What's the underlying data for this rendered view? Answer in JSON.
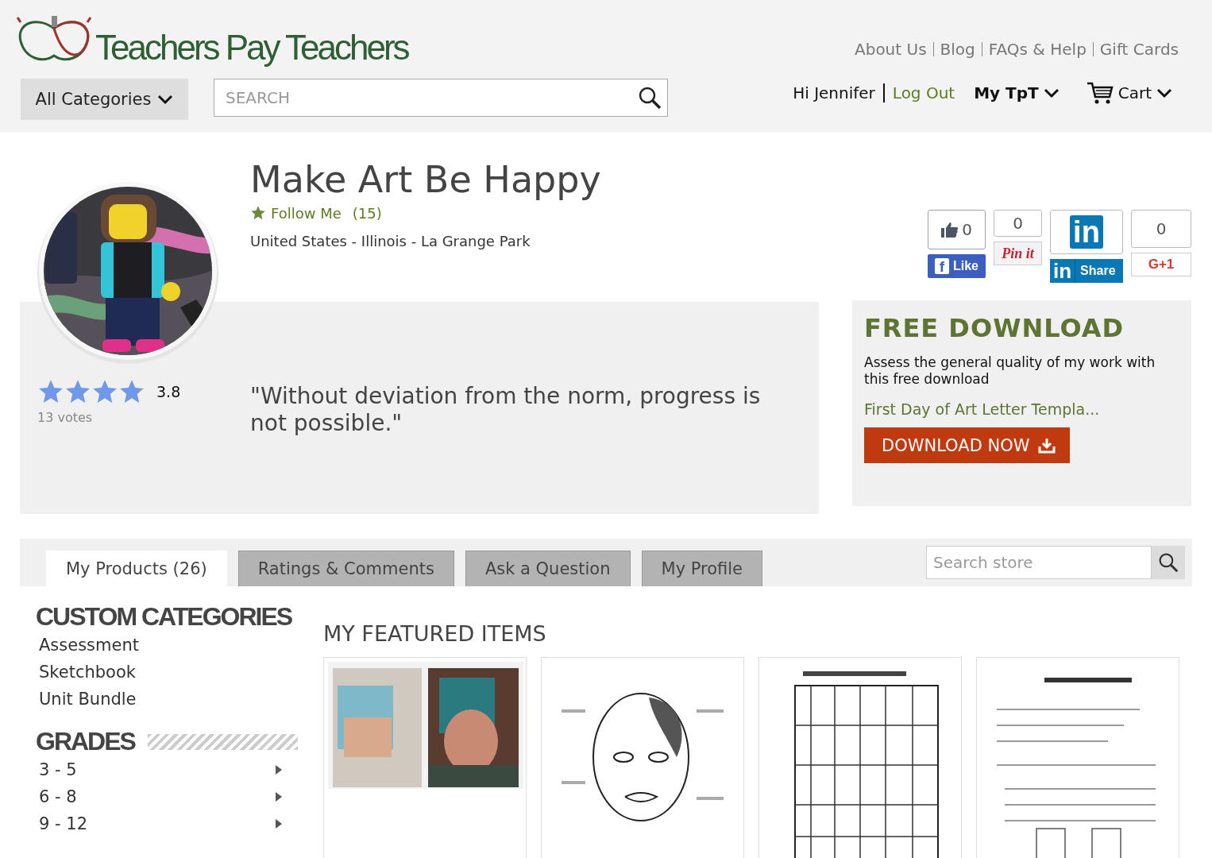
{
  "header": {
    "logo": "Teachers Pay Teachers",
    "top_links": [
      "About Us",
      "Blog",
      "FAQs & Help",
      "Gift Cards"
    ],
    "categories_button": "All Categories",
    "search": {
      "placeholder": "SEARCH"
    },
    "greeting": "Hi Jennifer",
    "logout": "Log Out",
    "my_tpt": "My TpT",
    "cart": "Cart"
  },
  "store": {
    "name": "Make Art Be Happy",
    "follow": "Follow Me",
    "followers": "(15)",
    "location": "United States - Illinois - La Grange Park",
    "rating": {
      "stars": 3.8,
      "value": "3.8",
      "votes": "13 votes"
    },
    "quote": "\"Without deviation from the norm, progress is not possible.\""
  },
  "social": [
    {
      "kind": "facebook",
      "count": "0",
      "mark": "f",
      "label": "Like"
    },
    {
      "kind": "pinterest",
      "count": "0",
      "label": "Pin it"
    },
    {
      "kind": "linkedin",
      "logo": "in",
      "mark": "in",
      "label": "Share"
    },
    {
      "kind": "google",
      "count": "0",
      "label": "G+1"
    }
  ],
  "free_download": {
    "title": "FREE DOWNLOAD",
    "description": "Assess the general quality of my work with this free download",
    "product": "First Day of Art Letter Templa...",
    "button": "DOWNLOAD NOW"
  },
  "tabs": [
    {
      "label": "My Products (26)",
      "selected": true
    },
    {
      "label": "Ratings & Comments",
      "selected": false
    },
    {
      "label": "Ask a Question",
      "selected": false
    },
    {
      "label": "My Profile",
      "selected": false
    }
  ],
  "store_search": {
    "placeholder": "Search store"
  },
  "sidebar": [
    {
      "title": "CUSTOM CATEGORIES",
      "kind": "list",
      "items": [
        "Assessment",
        "Sketchbook",
        "Unit Bundle"
      ]
    },
    {
      "title": "GRADES",
      "kind": "submenu",
      "items": [
        "3 - 5",
        "6 - 8",
        "9 - 12"
      ]
    }
  ],
  "featured": {
    "title": "MY FEATURED ITEMS"
  }
}
